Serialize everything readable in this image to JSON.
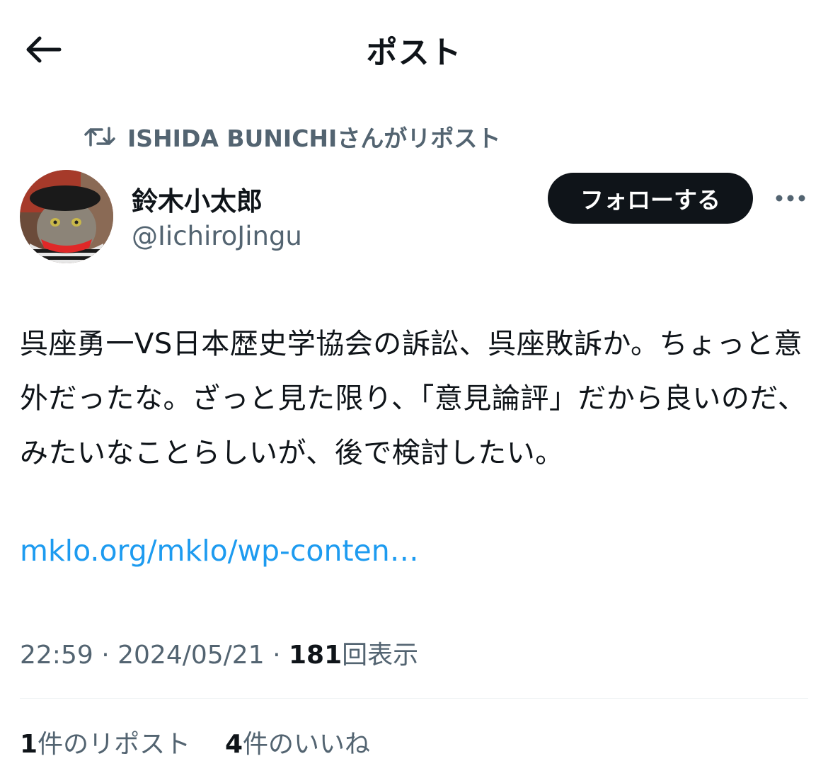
{
  "header": {
    "title": "ポスト"
  },
  "repost": {
    "text": "ISHIDA BUNICHIさんがリポスト"
  },
  "author": {
    "display_name": "鈴木小太郎",
    "handle": "@IichiroJingu"
  },
  "follow_button": {
    "label": "フォローする"
  },
  "post": {
    "text": "呉座勇一VS日本歴史学協会の訴訟、呉座敗訴か。ちょっと意外だったな。ざっと見た限り、「意見論評」だから良いのだ、みたいなことらしいが、後で検討したい。",
    "link": "mklo.org/mklo/wp-conten…"
  },
  "meta": {
    "time": "22:59",
    "separator": "·",
    "date": "2024/05/21",
    "views": "181",
    "views_label": "回表示"
  },
  "stats": {
    "reposts_count": "1",
    "reposts_label": "件のリポスト",
    "likes_count": "4",
    "likes_label": "件のいいね"
  },
  "icons": {
    "back": "arrow-left-icon",
    "repost": "repost-icon",
    "more": "more-dots-icon"
  },
  "colors": {
    "text": "#0f1419",
    "secondary": "#536471",
    "link": "#1d9bf0",
    "button_bg": "#0f1419"
  }
}
